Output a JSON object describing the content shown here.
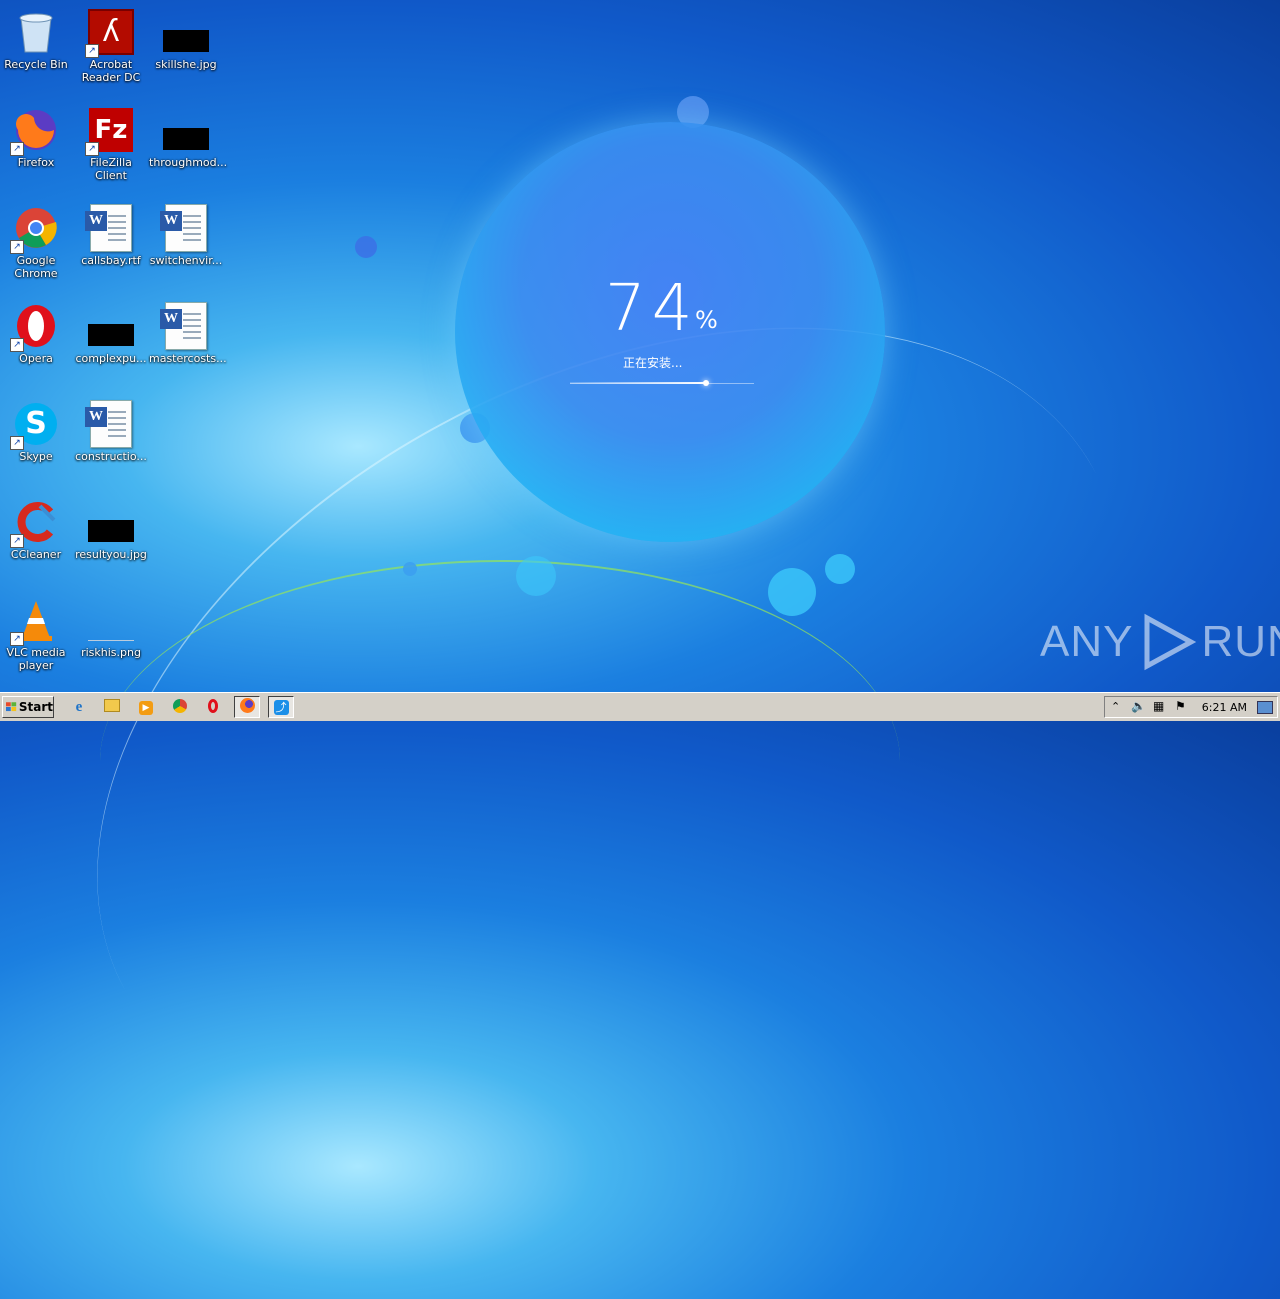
{
  "desktop": {
    "icons": [
      {
        "label": "Recycle Bin",
        "icon": "recycle-bin-icon"
      },
      {
        "label": "Acrobat Reader DC",
        "icon": "acrobat-icon"
      },
      {
        "label": "skillshe.jpg",
        "icon": "image-file-icon"
      },
      {
        "label": "Firefox",
        "icon": "firefox-icon"
      },
      {
        "label": "FileZilla Client",
        "icon": "filezilla-icon"
      },
      {
        "label": "throughmod...",
        "icon": "image-file-icon"
      },
      {
        "label": "Google Chrome",
        "icon": "chrome-icon"
      },
      {
        "label": "callsbay.rtf",
        "icon": "word-doc-icon"
      },
      {
        "label": "switchenvir...",
        "icon": "word-doc-icon"
      },
      {
        "label": "Opera",
        "icon": "opera-icon"
      },
      {
        "label": "complexpu...",
        "icon": "image-file-icon"
      },
      {
        "label": "mastercosts...",
        "icon": "word-doc-icon"
      },
      {
        "label": "Skype",
        "icon": "skype-icon"
      },
      {
        "label": "constructio...",
        "icon": "word-doc-icon"
      },
      {
        "label": "CCleaner",
        "icon": "ccleaner-icon"
      },
      {
        "label": "resultyou.jpg",
        "icon": "image-file-icon"
      },
      {
        "label": "VLC media player",
        "icon": "vlc-icon"
      },
      {
        "label": "riskhis.png",
        "icon": "image-file-icon"
      }
    ]
  },
  "installer": {
    "percent": "74",
    "percent_sign": "%",
    "status": "正在安装...",
    "progress": 0.74
  },
  "taskbar": {
    "start_label": "Start",
    "apps": [
      "internet-explorer-icon",
      "file-explorer-icon",
      "media-player-icon",
      "chrome-icon",
      "opera-icon",
      "firefox-icon",
      "installer-app-icon"
    ],
    "clock": "6:21 AM"
  },
  "watermark": {
    "text_left": "ANY",
    "text_right": "RUN"
  },
  "colors": {
    "taskbar": "#d4d0c8",
    "desktop_blue": "#1b7fe0",
    "installer_blue": "#3c8cf0"
  }
}
